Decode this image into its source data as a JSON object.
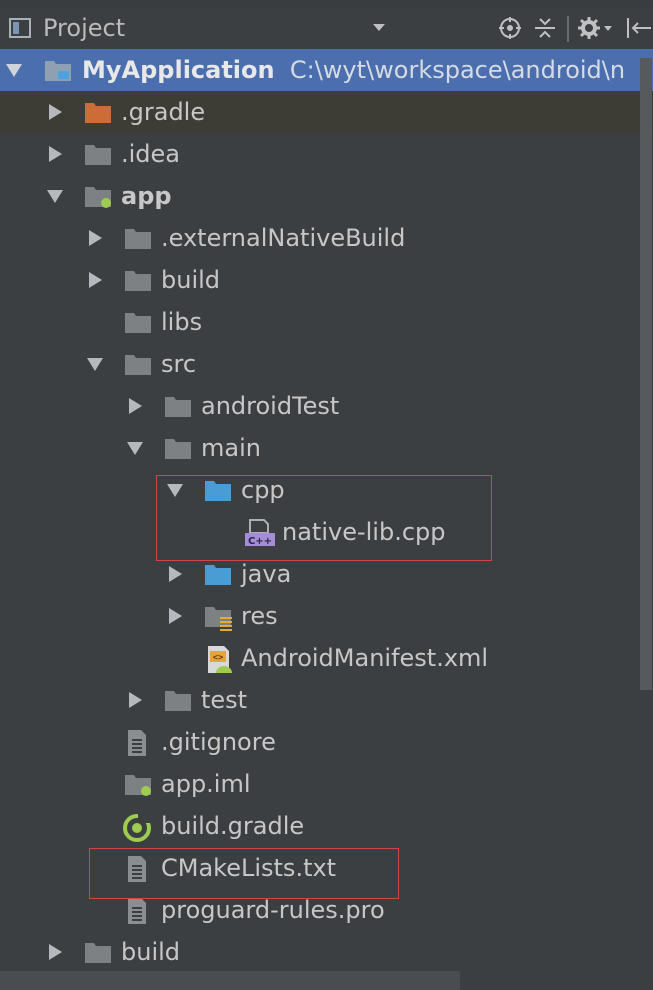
{
  "header": {
    "title": "Project",
    "icons": [
      "project-icon",
      "dropdown-icon",
      "locate-icon",
      "collapse-icon",
      "gear-icon",
      "hide-icon"
    ]
  },
  "tree": {
    "root": {
      "name": "MyApplication",
      "path": "C:\\wyt\\workspace\\android\\n"
    },
    "gradle": ".gradle",
    "idea": ".idea",
    "app": "app",
    "external_native_build": ".externalNativeBuild",
    "build_app": "build",
    "libs": "libs",
    "src": "src",
    "android_test": "androidTest",
    "main": "main",
    "cpp": "cpp",
    "native_lib": "native-lib.cpp",
    "java": "java",
    "res": "res",
    "manifest": "AndroidManifest.xml",
    "test": "test",
    "gitignore": ".gitignore",
    "app_iml": "app.iml",
    "build_gradle": "build.gradle",
    "cmake": "CMakeLists.txt",
    "proguard": "proguard-rules.pro",
    "build_root": "build"
  },
  "colors": {
    "background": "#3c3f41",
    "selection": "#4b6eaf",
    "folder": "#7d8184",
    "source_folder": "#4a9dd4",
    "excluded_folder": "#cc6d37",
    "module_dot": "#9ecc50",
    "cpp_badge": "#a48dd6",
    "highlight_box": "#d64545"
  }
}
